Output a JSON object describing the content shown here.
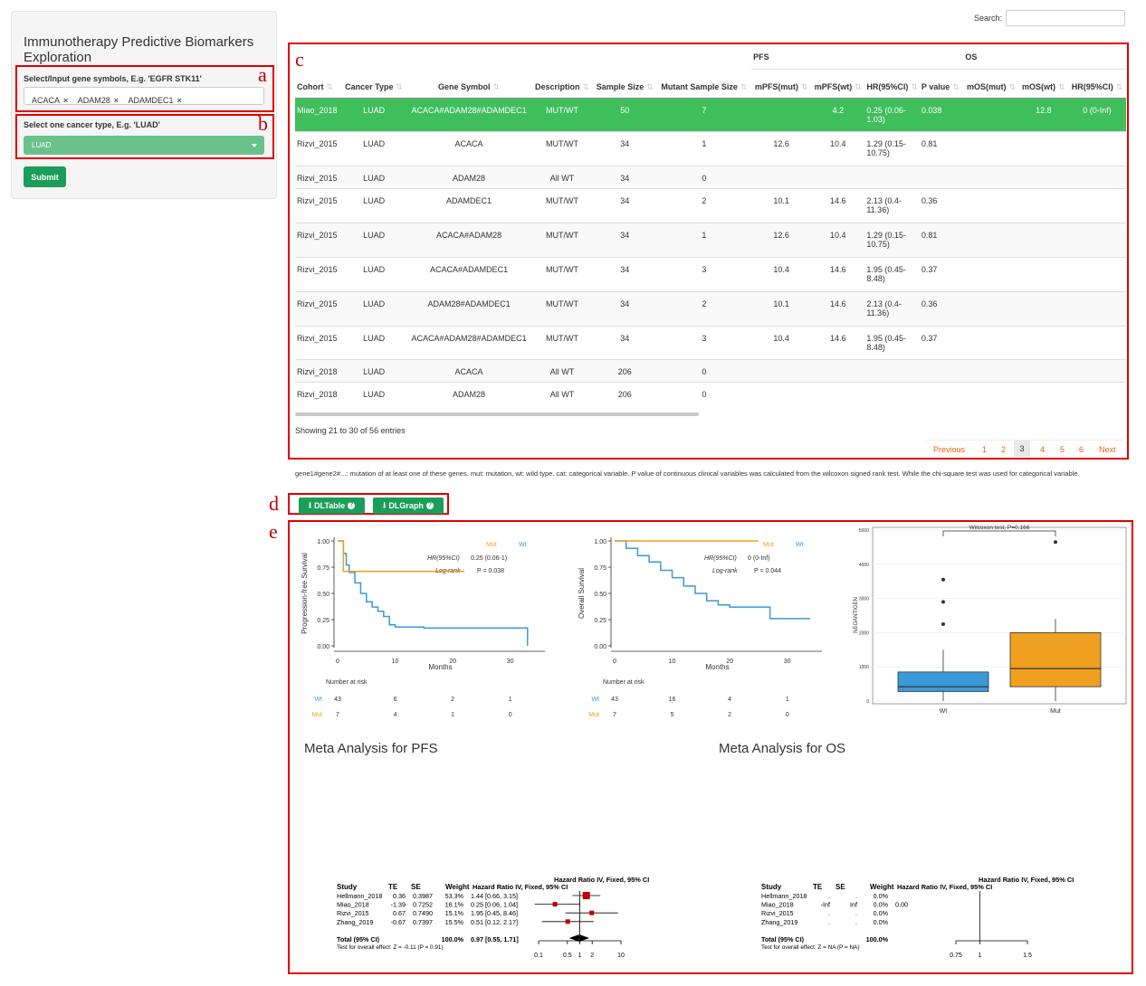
{
  "search": {
    "label": "Search:",
    "placeholder": ""
  },
  "sidebar": {
    "title": "Immunotherapy Predictive Biomarkers Exploration",
    "gene_label": "Select/Input gene symbols, E.g. 'EGFR STK11'",
    "genes": [
      "ACACA",
      "ADAM28",
      "ADAMDEC1"
    ],
    "cancer_label": "Select one cancer type, E.g. 'LUAD'",
    "cancer_value": "LUAD",
    "submit": "Submit"
  },
  "annotations": {
    "a": "a",
    "b": "b",
    "c": "c",
    "d": "d",
    "e": "e"
  },
  "table": {
    "group_pfs": "PFS",
    "group_os": "OS",
    "headers": [
      "Cohort",
      "Cancer Type",
      "Gene Symbol",
      "Description",
      "Sample Size",
      "Mutant Sample Size",
      "mPFS(mut)",
      "mPFS(wt)",
      "HR(95%CI)",
      "P value",
      "mOS(mut)",
      "mOS(wt)",
      "HR(95%CI)"
    ],
    "rows": [
      [
        "Miao_2018",
        "LUAD",
        "ACACA#ADAM28#ADAMDEC1",
        "MUT/WT",
        "50",
        "7",
        "",
        "4.2",
        "0.25 (0.06-1.03)",
        "0.038",
        "",
        "12.8",
        "0 (0-Inf)"
      ],
      [
        "Rizvi_2015",
        "LUAD",
        "ACACA",
        "MUT/WT",
        "34",
        "1",
        "12.6",
        "10.4",
        "1.29 (0.15-10.75)",
        "0.81",
        "",
        "",
        ""
      ],
      [
        "Rizvi_2015",
        "LUAD",
        "ADAM28",
        "All WT",
        "34",
        "0",
        "",
        "",
        "",
        "",
        "",
        "",
        ""
      ],
      [
        "Rizvi_2015",
        "LUAD",
        "ADAMDEC1",
        "MUT/WT",
        "34",
        "2",
        "10.1",
        "14.6",
        "2.13 (0.4-11.36)",
        "0.36",
        "",
        "",
        ""
      ],
      [
        "Rizvi_2015",
        "LUAD",
        "ACACA#ADAM28",
        "MUT/WT",
        "34",
        "1",
        "12.6",
        "10.4",
        "1.29 (0.15-10.75)",
        "0.81",
        "",
        "",
        ""
      ],
      [
        "Rizvi_2015",
        "LUAD",
        "ACACA#ADAMDEC1",
        "MUT/WT",
        "34",
        "3",
        "10.4",
        "14.6",
        "1.95 (0.45-8.48)",
        "0.37",
        "",
        "",
        ""
      ],
      [
        "Rizvi_2015",
        "LUAD",
        "ADAM28#ADAMDEC1",
        "MUT/WT",
        "34",
        "2",
        "10.1",
        "14.6",
        "2.13 (0.4-11.36)",
        "0.36",
        "",
        "",
        ""
      ],
      [
        "Rizvi_2015",
        "LUAD",
        "ACACA#ADAM28#ADAMDEC1",
        "MUT/WT",
        "34",
        "3",
        "10.4",
        "14.6",
        "1.95 (0.45-8.48)",
        "0.37",
        "",
        "",
        ""
      ],
      [
        "Rizvi_2018",
        "LUAD",
        "ACACA",
        "All WT",
        "206",
        "0",
        "",
        "",
        "",
        "",
        "",
        "",
        ""
      ],
      [
        "Rizvi_2018",
        "LUAD",
        "ADAM28",
        "All WT",
        "206",
        "0",
        "",
        "",
        "",
        "",
        "",
        "",
        ""
      ]
    ],
    "info": "Showing 21 to 30 of 56 entries",
    "pagination": [
      "Previous",
      "1",
      "2",
      "3",
      "4",
      "5",
      "6",
      "Next"
    ]
  },
  "footnote": "gene1#gene2#...: mutation of at least one of these genes. mut: mutation, wt: wild type. cat: categorical variable. P value of continuous clinical variables was calculated from the wilcoxon signed rank test. While the chi-square test was used for categorical variable.",
  "buttons": {
    "dltable": "DLTable",
    "dlgraph": "DLGraph"
  },
  "colors": {
    "wt": "#3a9ad9",
    "mut": "#f0a020",
    "green": "#1a9e5a",
    "selected": "#3fbe5c",
    "red": "#e00000"
  },
  "chart_data": [
    {
      "type": "line",
      "title": "",
      "ylabel": "Progression-free Survival",
      "xlabel": "Months",
      "xticks": [
        "0",
        "10",
        "20",
        "30"
      ],
      "yticks": [
        "0.00",
        "0.25",
        "0.50",
        "0.75",
        "1.00"
      ],
      "legend": [
        "Mut",
        "Wt"
      ],
      "annotation": {
        "hr_label": "HR(95%CI)",
        "hr_value": "0.25 (0.06-1)",
        "lr_label": "Log-rank",
        "lr_value": "P = 0.038"
      },
      "series": [
        {
          "name": "Wt",
          "x": [
            0,
            1,
            1.5,
            2,
            3,
            4,
            5,
            6,
            7,
            8,
            9,
            10,
            15,
            25,
            33,
            33
          ],
          "y": [
            1.0,
            0.88,
            0.77,
            0.7,
            0.6,
            0.5,
            0.42,
            0.37,
            0.33,
            0.28,
            0.2,
            0.18,
            0.17,
            0.17,
            0.17,
            0.0
          ]
        },
        {
          "name": "Mut",
          "x": [
            0,
            1,
            2,
            10,
            22
          ],
          "y": [
            1.0,
            0.71,
            0.71,
            0.71,
            0.71
          ]
        }
      ],
      "risk_label": "Number at risk",
      "risk": {
        "Wt": [
          "43",
          "6",
          "2",
          "1"
        ],
        "Mut": [
          "7",
          "4",
          "1",
          "0"
        ]
      }
    },
    {
      "type": "line",
      "title": "",
      "ylabel": "Overall Survival",
      "xlabel": "Months",
      "xticks": [
        "0",
        "10",
        "20",
        "30"
      ],
      "yticks": [
        "0.00",
        "0.25",
        "0.50",
        "0.75",
        "1.00"
      ],
      "legend": [
        "Mut",
        "Wt"
      ],
      "annotation": {
        "hr_label": "HR(95%CI)",
        "hr_value": "0 (0-Inf)",
        "lr_label": "Log-rank",
        "lr_value": "P = 0.044"
      },
      "series": [
        {
          "name": "Wt",
          "x": [
            0,
            2,
            4,
            6,
            8,
            10,
            12,
            14,
            16,
            18,
            20,
            27,
            34
          ],
          "y": [
            1.0,
            0.93,
            0.86,
            0.8,
            0.72,
            0.65,
            0.57,
            0.5,
            0.43,
            0.39,
            0.37,
            0.26,
            0.26
          ]
        },
        {
          "name": "Mut",
          "x": [
            0,
            25
          ],
          "y": [
            1.0,
            1.0
          ]
        }
      ],
      "risk_label": "Number at risk",
      "risk": {
        "Wt": [
          "43",
          "16",
          "4",
          "1"
        ],
        "Mut": [
          "7",
          "5",
          "2",
          "0"
        ]
      }
    },
    {
      "type": "box",
      "ylabel": "NEOANTIGEN",
      "title": "Wilcoxon test, P=0.166",
      "categories": [
        "Wt",
        "Mut"
      ],
      "yticks": [
        "0",
        "1000",
        "2000",
        "3000",
        "4000",
        "5000"
      ],
      "ylim": [
        0,
        5000
      ],
      "boxes": [
        {
          "name": "Wt",
          "min": 0,
          "q1": 280,
          "median": 420,
          "q3": 850,
          "max": 1500,
          "outliers": [
            2250,
            2900,
            3550
          ]
        },
        {
          "name": "Mut",
          "min": 0,
          "q1": 420,
          "median": 950,
          "q3": 2000,
          "max": 2400,
          "outliers": [
            4650
          ]
        }
      ]
    }
  ],
  "meta": {
    "pfs_title": "Meta Analysis for PFS",
    "os_title": "Meta Analysis for OS",
    "pfs": {
      "header": [
        "Study",
        "TE",
        "SE",
        "Weight",
        "Hazard Ratio IV, Fixed, 95% CI",
        "Hazard Ratio IV, Fixed, 95% CI"
      ],
      "rows": [
        [
          "Hellmann_2018",
          "0.36",
          "0.3987",
          "53.3%",
          "1.44 [0.66, 3.15]"
        ],
        [
          "Miao_2018",
          "-1.39",
          "0.7252",
          "16.1%",
          "0.25 [0.06, 1.04]"
        ],
        [
          "Rizvi_2015",
          "0.67",
          "0.7490",
          "15.1%",
          "1.95 [0.45, 8.46]"
        ],
        [
          "Zhang_2019",
          "-0.67",
          "0.7397",
          "15.5%",
          "0.51 [0.12, 2.17]"
        ]
      ],
      "total": [
        "Total (95% CI)",
        "100.0%",
        "0.97 [0.55, 1.71]"
      ],
      "test": "Test for overall effect: Z = -0.11 (P = 0.91)",
      "axis": [
        "0.1",
        "0.5",
        "1",
        "2",
        "10"
      ]
    },
    "os": {
      "header": [
        "Study",
        "TE",
        "SE",
        "Weight",
        "Hazard Ratio IV, Fixed, 95% CI",
        "Hazard Ratio IV, Fixed, 95% CI"
      ],
      "rows": [
        [
          "Hellmann_2018",
          ".",
          ".",
          "0.0%",
          ""
        ],
        [
          "Miao_2018",
          "-Inf",
          "Inf",
          "0.0%",
          "0.00"
        ],
        [
          "Rizvi_2015",
          ".",
          ".",
          "0.0%",
          ""
        ],
        [
          "Zhang_2019",
          ".",
          ".",
          "0.0%",
          ""
        ]
      ],
      "total": [
        "Total (95% CI)",
        "100.0%",
        ""
      ],
      "test": "Test for overall effect: Z = NA (P = NA)",
      "axis": [
        "0.75",
        "1",
        "1.5"
      ]
    }
  }
}
